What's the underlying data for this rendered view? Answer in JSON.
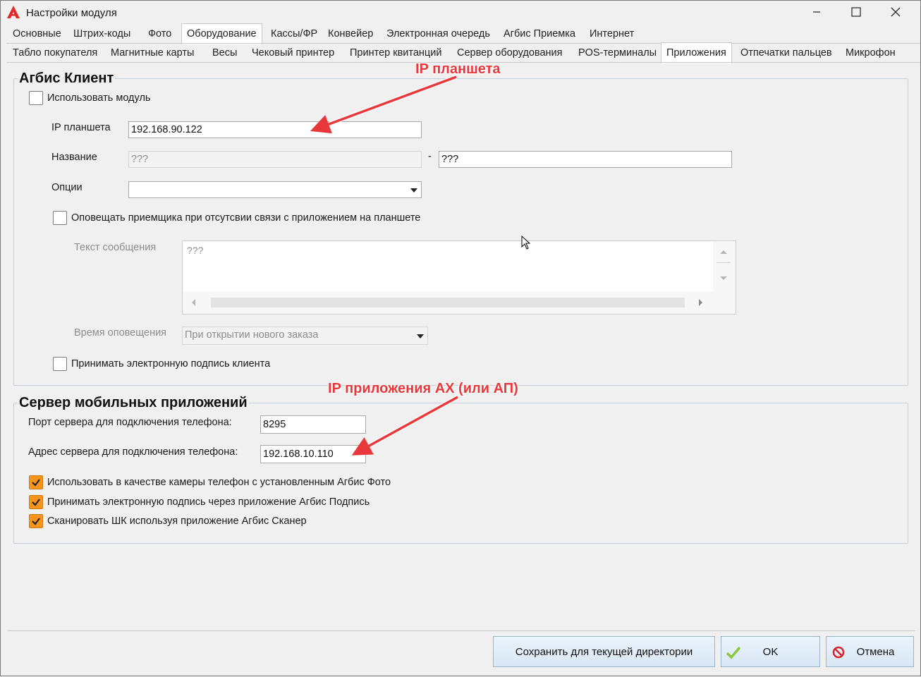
{
  "window": {
    "title": "Настройки модуля"
  },
  "tabs_row1": [
    "Основные",
    "Штрих-коды",
    "Фото",
    "Оборудование",
    "Кассы/ФР",
    "Конвейер",
    "Электронная очередь",
    "Агбис Приемка",
    "Интернет"
  ],
  "tabs_row2": [
    "Табло покупателя",
    "Магнитные карты",
    "Весы",
    "Чековый принтер",
    "Принтер квитанций",
    "Сервер оборудования",
    "POS-терминалы",
    "Приложения",
    "Отпечатки пальцев",
    "Микрофон"
  ],
  "client": {
    "title": "Агбис Клиент",
    "use_module": "Использовать модуль",
    "ip_label": "IP планшета",
    "ip_value": "192.168.90.122",
    "name_label": "Название",
    "name_value1": "???",
    "name_sep": "-",
    "name_value2": "???",
    "options_label": "Опции",
    "options_value": "",
    "notify_label": "Оповещать приемщика при отсутсвии связи с приложением на планшете",
    "message_label": "Текст сообщения",
    "message_value": "???",
    "notify_time_label": "Время оповещения",
    "notify_time_value": "При открытии нового заказа",
    "accept_sign_label": "Принимать электронную подпись клиента"
  },
  "server": {
    "title": "Сервер мобильных приложений",
    "port_label": "Порт сервера для подключения телефона:",
    "port_value": "8295",
    "addr_label": "Адрес сервера для подключения телефона:",
    "addr_value": "192.168.10.110",
    "camera_label": "Использовать в качестве камеры телефон с установленным Агбис Фото",
    "sign_label": "Принимать электронную подпись через приложение Агбис Подпись",
    "scan_label": "Сканировать ШК используя приложение Агбис Сканер"
  },
  "annotations": {
    "ip_tablet": "IP планшета",
    "ip_app": "IP приложения АХ (или АП)"
  },
  "buttons": {
    "save_dir": "Сохранить для текущей директории",
    "ok": "OK",
    "cancel": "Отмена"
  },
  "colors": {
    "accent_check": "#f7941d",
    "annotation": "#e8383c",
    "button_bg": "#dce9f5"
  }
}
